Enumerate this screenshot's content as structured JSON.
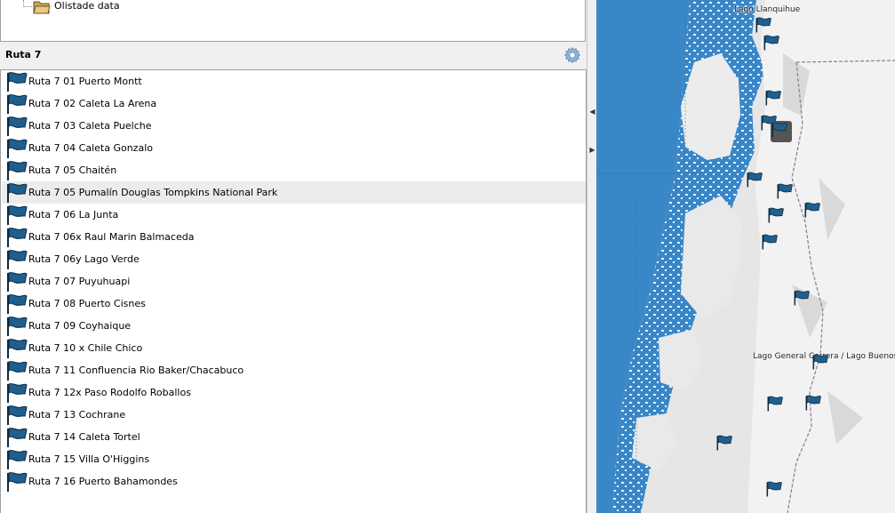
{
  "tree": {
    "item_label": "Olistade data"
  },
  "section": {
    "title": "Ruta 7"
  },
  "colors": {
    "flag_blue": "#1f5f8f",
    "water": "#3a87c8",
    "land": "#e8e8e8",
    "selected_row": "#ececec"
  },
  "icons": {
    "settings": "gear-icon",
    "placemark": "flag-icon",
    "folder": "folder-icon"
  },
  "list": {
    "items": [
      {
        "label": "Ruta 7 01 Puerto Montt"
      },
      {
        "label": "Ruta 7 02 Caleta La Arena"
      },
      {
        "label": "Ruta 7 03 Caleta Puelche"
      },
      {
        "label": "Ruta 7 04 Caleta Gonzalo"
      },
      {
        "label": "Ruta 7 05 Chaitén"
      },
      {
        "label": "Ruta 7 05 Pumalín Douglas Tompkins National Park"
      },
      {
        "label": "Ruta 7 06 La Junta"
      },
      {
        "label": "Ruta 7 06x Raul Marin Balmaceda"
      },
      {
        "label": "Ruta 7 06y Lago Verde"
      },
      {
        "label": "Ruta 7 07 Puyuhuapi"
      },
      {
        "label": "Ruta 7 08 Puerto Cisnes"
      },
      {
        "label": "Ruta 7 09 Coyhaique"
      },
      {
        "label": "Ruta 7 10 x Chile Chico"
      },
      {
        "label": "Ruta 7 11 Confluencia Rio Baker/Chacabuco"
      },
      {
        "label": "Ruta 7 12x Paso Rodolfo Roballos"
      },
      {
        "label": "Ruta 7 13 Cochrane"
      },
      {
        "label": "Ruta 7 14 Caleta Tortel"
      },
      {
        "label": "Ruta 7 15 Villa O'Higgins"
      },
      {
        "label": "Ruta 7 16 Puerto Bahamondes"
      }
    ],
    "selected_index": 5
  },
  "map": {
    "labels": {
      "lago_llanquihue": "Lago Llanquihue",
      "lago_general_carrera": "Lago General Carrera / Lago Buenos Aires"
    }
  }
}
